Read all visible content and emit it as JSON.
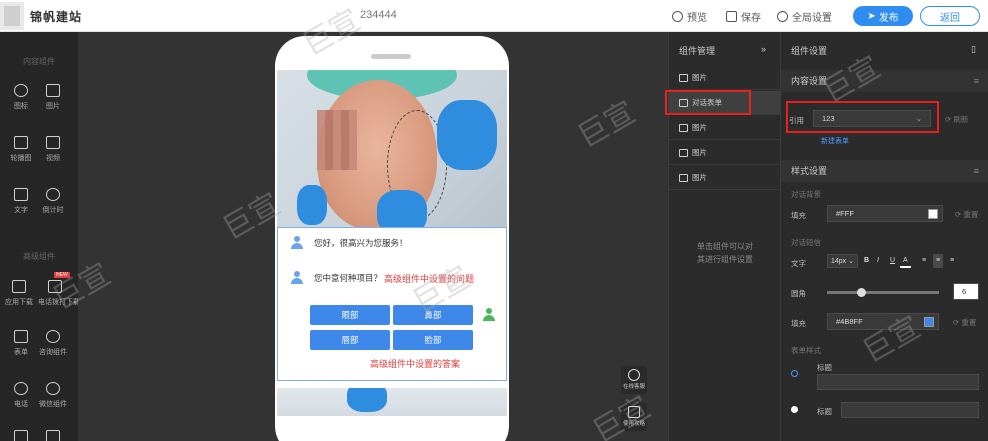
{
  "topbar": {
    "site_title": "锦帆建站",
    "page_id": "234444",
    "preview_label": "预览",
    "save_label": "保存",
    "global_settings_label": "全局设置",
    "publish_label": "发布",
    "back_label": "返回"
  },
  "left_sidebar": {
    "section_basic": "内容组件",
    "section_advanced": "高级组件",
    "tools": [
      {
        "label": "图标"
      },
      {
        "label": "图片"
      },
      {
        "label": "轮播图"
      },
      {
        "label": "视频"
      },
      {
        "label": "文字"
      },
      {
        "label": "倒计时"
      },
      {
        "label": "应用下载"
      },
      {
        "label": "电话拨打下载"
      },
      {
        "label": "表单"
      },
      {
        "label": "咨询组件"
      },
      {
        "label": "电话"
      },
      {
        "label": "微信组件"
      }
    ],
    "new_badge": "NEW"
  },
  "canvas": {
    "chat": {
      "greeting": "您好，很高兴为您服务！",
      "question": "您中意何种项目？",
      "question_note": "高级组件中设置的问题",
      "options": [
        "眼部",
        "鼻部",
        "唇部",
        "脸部"
      ],
      "answer_note": "高级组件中设置的答案"
    },
    "float_buttons": [
      {
        "label": "在线客服"
      },
      {
        "label": "使用攻略"
      }
    ]
  },
  "component_manager": {
    "title": "组件管理",
    "collapse_icon": "»",
    "items": [
      {
        "label": "图片",
        "active": false
      },
      {
        "label": "对话表单",
        "active": true
      },
      {
        "label": "图片",
        "active": false
      },
      {
        "label": "图片",
        "active": false
      },
      {
        "label": "图片",
        "active": false
      }
    ],
    "hint": "单击组件可以对\n其进行组件设置"
  },
  "component_settings": {
    "title": "组件设置",
    "content_section": "内容设置",
    "reference_label": "引用",
    "reference_value": "123",
    "refresh_label": "刷新",
    "new_form_link": "新建表单",
    "style_section": "样式设置",
    "dialog_bg_label": "对话背景",
    "fill_label": "填充",
    "fill_value": "#FFF",
    "reset_label": "重置",
    "dialog_text_label": "对话短信",
    "text_label": "文字",
    "font_size_value": "14px",
    "format_buttons": [
      "B",
      "I",
      "U",
      "A"
    ],
    "radius_label": "圆角",
    "radius_value": "6",
    "fill2_label": "填充",
    "fill2_value": "#4B8FF",
    "reset2_label": "重置",
    "form_style_label": "表单样式",
    "title_label_1": "标题",
    "title_label_2": "标题"
  },
  "watermark": "巨宣",
  "colors": {
    "accent": "#2f8cf0",
    "highlight": "#e8211d",
    "option_button": "#3d88e8"
  }
}
